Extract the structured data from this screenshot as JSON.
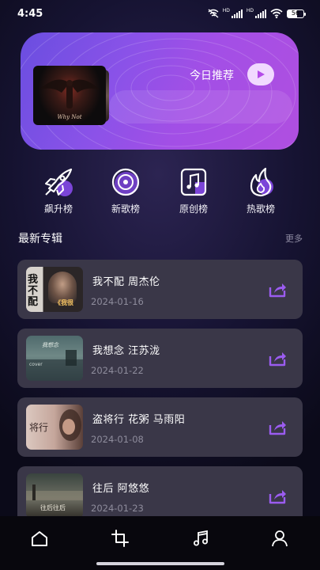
{
  "status_bar": {
    "time": "4:45",
    "battery": "56",
    "signal_label": "HD"
  },
  "banner": {
    "recommend_label": "今日推荐",
    "cover_caption": "Why Not"
  },
  "categories": [
    {
      "label": "飙升榜",
      "icon": "rocket-icon"
    },
    {
      "label": "新歌榜",
      "icon": "vinyl-disc-icon"
    },
    {
      "label": "原创榜",
      "icon": "music-note-doc-icon"
    },
    {
      "label": "热歌榜",
      "icon": "flame-icon"
    }
  ],
  "section": {
    "title": "最新专辑",
    "more": "更多"
  },
  "albums": [
    {
      "title": "我不配 周杰伦",
      "date": "2024-01-16",
      "cover_text": "我不配",
      "cover_caption": "《我很"
    },
    {
      "title": "我想念 汪苏泷",
      "date": "2024-01-22",
      "cover_text": "cover"
    },
    {
      "title": "盗将行 花粥 马雨阳",
      "date": "2024-01-08",
      "cover_text": "将行"
    },
    {
      "title": "往后 阿悠悠",
      "date": "2024-01-23",
      "cover_text": "往后往后"
    }
  ],
  "nav": [
    {
      "name": "home",
      "icon": "home-icon"
    },
    {
      "name": "crop",
      "icon": "crop-icon"
    },
    {
      "name": "music",
      "icon": "music-note-icon"
    },
    {
      "name": "profile",
      "icon": "person-icon"
    }
  ],
  "colors": {
    "accent_purple": "#8a52e8",
    "card_bg": "#3a3748",
    "share_icon": "#9b5cf0"
  }
}
